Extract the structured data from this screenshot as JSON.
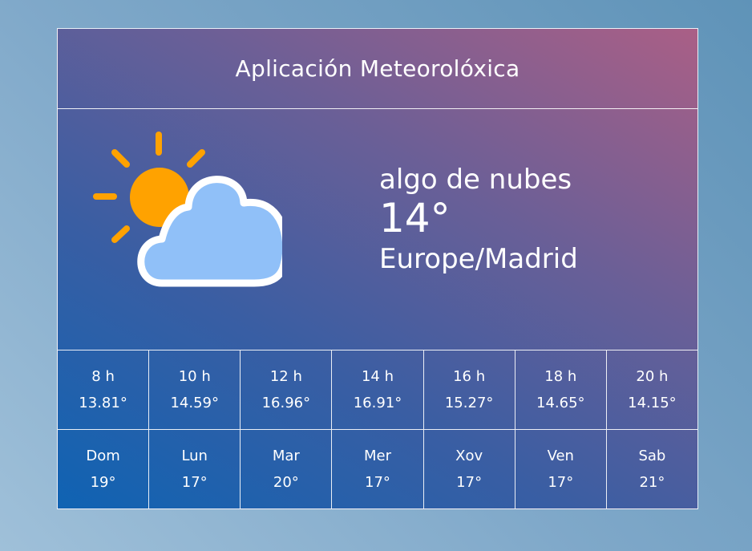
{
  "header": {
    "title": "Aplicación Meteorolóxica"
  },
  "current": {
    "icon": "partly-cloudy-icon",
    "description": "algo de nubes",
    "temperature": "14°",
    "location": "Europe/Madrid"
  },
  "hourly": [
    {
      "label": "8 h",
      "temp": "13.81°"
    },
    {
      "label": "10 h",
      "temp": "14.59°"
    },
    {
      "label": "12 h",
      "temp": "16.96°"
    },
    {
      "label": "14 h",
      "temp": "16.91°"
    },
    {
      "label": "16 h",
      "temp": "15.27°"
    },
    {
      "label": "18 h",
      "temp": "14.65°"
    },
    {
      "label": "20 h",
      "temp": "14.15°"
    }
  ],
  "daily": [
    {
      "label": "Dom",
      "temp": "19°"
    },
    {
      "label": "Lun",
      "temp": "17°"
    },
    {
      "label": "Mar",
      "temp": "20°"
    },
    {
      "label": "Mer",
      "temp": "17°"
    },
    {
      "label": "Xov",
      "temp": "17°"
    },
    {
      "label": "Ven",
      "temp": "17°"
    },
    {
      "label": "Sab",
      "temp": "21°"
    }
  ],
  "colors": {
    "sun": "#ffa200",
    "cloud": "#90c0f8",
    "cloud_outline": "#ffffff"
  }
}
